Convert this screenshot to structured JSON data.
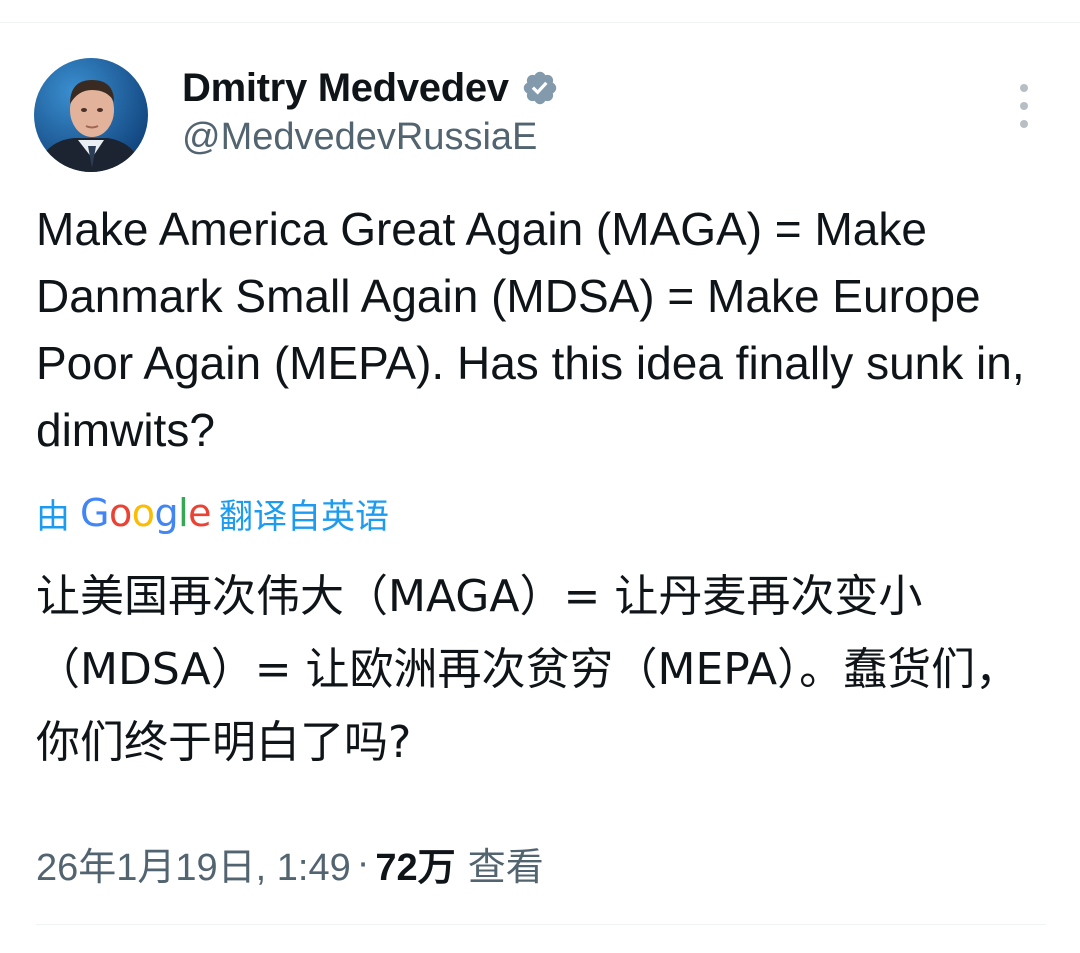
{
  "user": {
    "display_name": "Dmitry Medvedev",
    "handle": "@MedvedevRussiaE",
    "verified": true,
    "verified_color": "#829aab"
  },
  "tweet": {
    "text": "Make America Great Again (MAGA) = Make Danmark Small Again (MDSA) = Make Europe Poor Again (MEPA). Has this idea finally sunk in, dimwits?",
    "translated_by_prefix": "由",
    "translated_by_brand": "Google",
    "translated_by_suffix": "翻译自英语",
    "translation": "让美国再次伟大（MAGA）= 让丹麦再次变小（MDSA）= 让欧洲再次贫穷（MEPA）。蠢货们，你们终于明白了吗?"
  },
  "meta": {
    "timestamp": "26年1月19日, 1:49",
    "separator": "·",
    "views_count": "72万",
    "views_label": "查看"
  },
  "icons": {
    "more": "more-vertical-icon",
    "verified": "verified-badge-icon"
  },
  "colors": {
    "link": "#1d9bf0",
    "secondary_text": "#536471",
    "primary_text": "#0f1419"
  }
}
